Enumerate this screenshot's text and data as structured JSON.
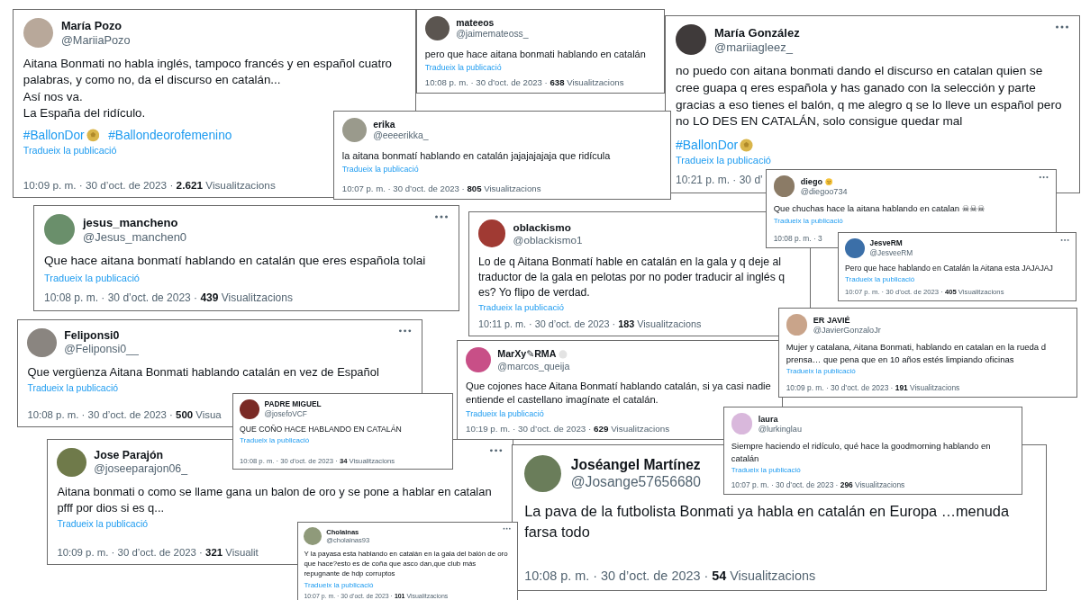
{
  "posts": [
    {
      "kind": "plain",
      "name": "María Pozo",
      "handle": "@MariiaPozo",
      "menu": false,
      "body": "Aitana Bonmati no habla inglés, tampoco francés y en español cuatro palabras, y como no, da el discurso en catalán...\nAsí nos va.\nLa España del ridículo.",
      "hashtags": [
        {
          "kind": "ball",
          "text": "#BallonDor"
        },
        {
          "kind": "plain",
          "text": "#Ballondeorofemenino"
        }
      ],
      "translate": "Tradueix la publicació",
      "footer": "10:09 p. m. · 30 d’oct. de 2023 · **2.621** Visualitzacions"
    },
    {
      "kind": "plain",
      "name": "mateeos",
      "handle": "@jaimemateoss_",
      "menu": false,
      "body": "pero que hace aitana bonmati hablando en catalán",
      "translate": "Tradueix la publicació",
      "footer": "10:08 p. m. · 30 d’oct. de 2023 · **638** Visualitzacions"
    },
    {
      "kind": "plain",
      "name": "María González",
      "handle": "@mariiagleez_",
      "menu": true,
      "body": "no puedo con aitana bonmati dando el discurso en catalan quien se cree guapa q eres española y has ganado con la selección y parte gracias a eso tienes el balón, q me alegro q se lo lleve un español pero no LO DES EN CATALÁN, solo consigue quedar mal",
      "hashtags": [
        {
          "kind": "ball",
          "text": "#BallonDor"
        }
      ],
      "translate": "Tradueix la publicació",
      "footer": "10:21 p. m. · 30 d’"
    },
    {
      "kind": "plain",
      "name": "erika",
      "handle": "@eeeerikka_",
      "menu": false,
      "body": "la aitana bonmatí hablando en catalán jajajajajaja que ridícula",
      "translate": "Tradueix la publicació",
      "footer": "10:07 p. m. · 30 d’oct. de 2023 · **805** Visualitzacions"
    },
    {
      "kind": "emoji",
      "name": "diego",
      "handle": "@diegoo734",
      "menu": true,
      "body": "Que chuchas hace la aitana hablando en catalan ☠☠☠",
      "translate": "Tradueix la publicació",
      "footer": "10:08 p. m. · 3"
    },
    {
      "kind": "plain",
      "name": "jesus_mancheno",
      "handle": "@Jesus_manchen0",
      "menu": true,
      "body": "Que hace aitana bonmatí hablando en catalán que eres española tolai",
      "translate": "Tradueix la publicació",
      "footer": "10:08 p. m. · 30 d’oct. de 2023 · **439** Visualitzacions"
    },
    {
      "kind": "plain",
      "name": "oblackismo",
      "handle": "@oblackismo1",
      "menu": false,
      "body": "Lo de q Aitana Bonmatí hable en catalán en la gala y q deje al traductor de la gala en pelotas por no poder traducir al inglés q es? Yo flipo de verdad.",
      "translate": "Tradueix la publicació",
      "footer": "10:11 p. m. · 30 d’oct. de 2023 · **183** Visualitzacions"
    },
    {
      "kind": "plain",
      "name": "JesveRM",
      "handle": "@JesveeRM",
      "menu": true,
      "body": "Pero que hace hablando en Catalán la Aitana esta JAJAJAJ",
      "translate": "Tradueix la publicació",
      "footer": "10:07 p. m. · 30 d’oct. de 2023 · **405** Visualitzacions"
    },
    {
      "kind": "plain",
      "name": "ER JAVIÉ",
      "handle": "@JavierGonzaloJr",
      "menu": false,
      "body": "Mujer y catalana, Aitana Bonmati, hablando en catalan en la rueda d prensa… que pena que en 10 años estés limpiando oficinas",
      "translate": "Tradueix la publicació",
      "footer": "10:09 p. m. · 30 d’oct. de 2023 · **191** Visualitzacions"
    },
    {
      "kind": "plain",
      "name": "Feliponsi0",
      "handle": "@Feliponsi0__",
      "menu": true,
      "body": "Que vergüenza Aitana Bonmati hablando catalán en vez de Español",
      "translate": "Tradueix la publicació",
      "footer": "10:08 p. m. · 30 d’oct. de 2023 · **500** Visua"
    },
    {
      "kind": "badge",
      "name": "MarXy✎RMA",
      "handle": "@marcos_queija",
      "menu": false,
      "body": "Que cojones hace Aitana Bonmatí hablando catalán, si ya casi nadie entiende el castellano imagínate el catalán.",
      "translate": "Tradueix la publicació",
      "footer": "10:19 p. m. · 30 d’oct. de 2023 · **629** Visualitzacions"
    },
    {
      "kind": "plain",
      "name": "PADRE MIGUEL",
      "handle": "@josefoVCF",
      "menu": false,
      "body": "QUE COÑO HACE HABLANDO EN CATALÁN",
      "translate": "Tradueix la publicació",
      "footer": "10:08 p. m. · 30 d’oct. de 2023 · **34** Visualitzacions"
    },
    {
      "kind": "plain",
      "name": "laura",
      "handle": "@lurkinglau",
      "menu": false,
      "body": "Siempre haciendo el ridículo, qué hace la goodmorning hablando en catalán",
      "translate": "Tradueix la publicació",
      "footer": "10:07 p. m. · 30 d’oct. de 2023 · **296** Visualitzacions"
    },
    {
      "kind": "plain",
      "name": "Jose Parajón",
      "handle": "@joseeparajon06_",
      "menu": true,
      "body": "Aitana bonmati o como se llame gana un balon de oro y se pone a hablar en catalan pfff por dios si es q...",
      "translate": "Tradueix la publicació",
      "footer": "10:09 p. m. · 30 d’oct. de 2023 · **321** Visualit"
    },
    {
      "kind": "plain",
      "name": "Joséangel Martínez",
      "handle": "@Josange57656680",
      "menu": false,
      "body": "La pava de la futbolista Bonmati ya habla en catalán en Europa …menuda farsa todo",
      "footer": "10:08 p. m. · 30 d’oct. de 2023 · **54** Visualitzacions"
    },
    {
      "kind": "plain",
      "name": "Cholainas",
      "handle": "@cholainas93",
      "menu": true,
      "body": "Y la payasa esta hablando en catalán en la gala del balón de oro que hace?esto es de coña que asco dan,que club más repugnante de hdp corruptos",
      "translate": "Tradueix la publicació",
      "footer": "10:07 p. m. · 30 d’oct. de 2023 · **101** Visualitzacions"
    }
  ]
}
